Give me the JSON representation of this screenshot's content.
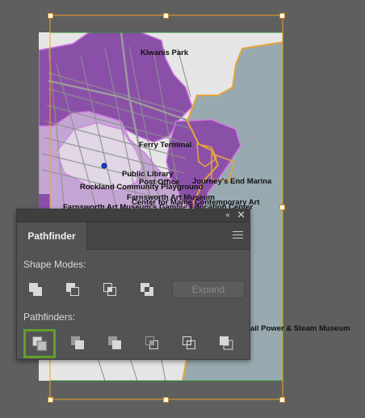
{
  "map": {
    "labels": [
      {
        "key": "kiwanis",
        "text": "Kiwanis Park"
      },
      {
        "key": "ferry",
        "text": "Ferry Terminal"
      },
      {
        "key": "library",
        "text": "Public Library"
      },
      {
        "key": "postoffice",
        "text": "Post Office"
      },
      {
        "key": "marina",
        "text": "Journey's End Marina"
      },
      {
        "key": "playground",
        "text": "Rockland Community Playground"
      },
      {
        "key": "farnsworth",
        "text": "Farnsworth Art Museum"
      },
      {
        "key": "cmca",
        "text": "Center for Maine Contemporary Art"
      },
      {
        "key": "farnsworth_center",
        "text": "Farnsworth Art Museum's Gamble Education Center"
      },
      {
        "key": "rail",
        "text": "ail Power & Steam Museum"
      }
    ],
    "colors": {
      "water": "#98aab0",
      "land": "#e6e6e6",
      "purple_dark": "#8a50a8",
      "purple_light": "#c4a6d4",
      "highlight": "#e0d6e6",
      "roads": "#8f8f8f",
      "boundary": "#e8a33a",
      "selection": "#f0a020",
      "point": "#1c3fd0"
    }
  },
  "panel": {
    "tab_label": "Pathfinder",
    "collapse_icon": "«",
    "close_icon": "✕",
    "shape_modes_label": "Shape Modes:",
    "pathfinders_label": "Pathfinders:",
    "expand_label": "Expand",
    "shape_modes": [
      {
        "name": "unite-icon"
      },
      {
        "name": "minus-front-icon"
      },
      {
        "name": "intersect-icon"
      },
      {
        "name": "exclude-icon"
      }
    ],
    "pathfinders": [
      {
        "name": "divide-icon",
        "selected": true
      },
      {
        "name": "trim-icon"
      },
      {
        "name": "merge-icon"
      },
      {
        "name": "crop-icon"
      },
      {
        "name": "outline-icon"
      },
      {
        "name": "minus-back-icon"
      }
    ],
    "accent": "#5fa02b"
  }
}
